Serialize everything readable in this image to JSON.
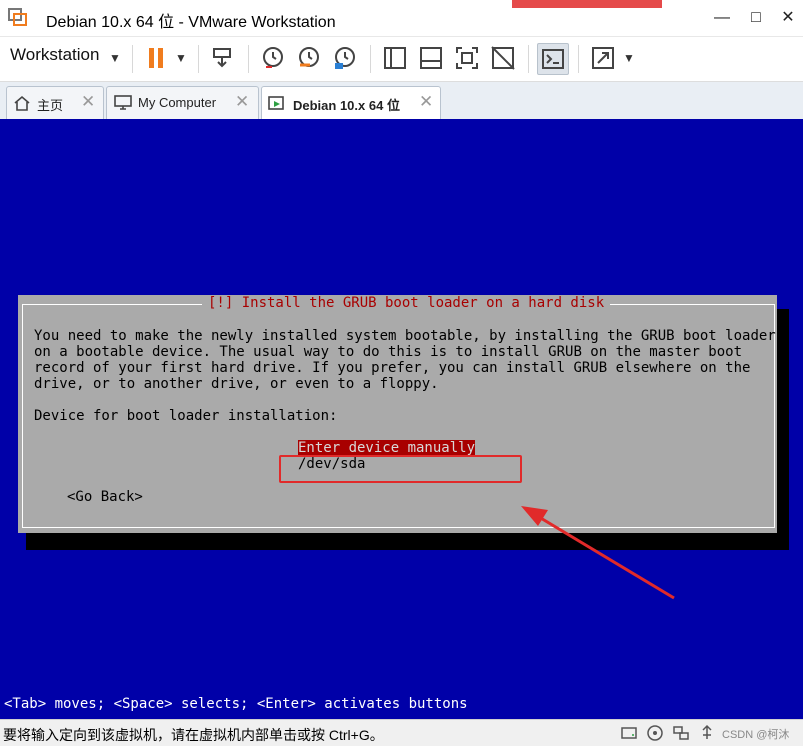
{
  "window": {
    "title": "Debian 10.x 64 位 - VMware Workstation"
  },
  "window_controls": {
    "minimize": "—",
    "maximize": "□",
    "close": "✕"
  },
  "toolbar": {
    "workstation_label": "Workstation"
  },
  "tabs": [
    {
      "label": "主页",
      "icon": "home-icon"
    },
    {
      "label": "My Computer",
      "icon": "monitor-icon"
    },
    {
      "label": "Debian 10.x 64 位",
      "icon": "vm-running-icon"
    }
  ],
  "tab_close": "✕",
  "installer": {
    "dialog_title": "[!] Install the GRUB boot loader on a hard disk",
    "description": [
      "You need to make the newly installed system bootable, by installing the GRUB boot loader",
      "on a bootable device. The usual way to do this is to install GRUB on the master boot",
      "record of your first hard drive. If you prefer, you can install GRUB elsewhere on the",
      "drive, or to another drive, or even to a floppy."
    ],
    "prompt": "Device for boot loader installation:",
    "options": [
      "Enter device manually",
      "/dev/sda"
    ],
    "selected_option": "Enter device manually",
    "go_back": "<Go Back>",
    "key_hint": "<Tab> moves; <Space> selects; <Enter> activates buttons"
  },
  "statusbar": {
    "message": "要将输入定向到该虚拟机，请在虚拟机内部单击或按 Ctrl+G。",
    "watermark": "CSDN @柯沐"
  },
  "colors": {
    "console_bg": "#0000a8",
    "dialog_bg": "#aaaaaa",
    "selection_bg": "#a80000",
    "annotation_red": "#e12a2a",
    "pause_orange": "#f07c1e"
  }
}
